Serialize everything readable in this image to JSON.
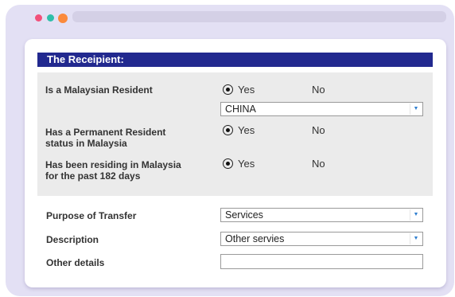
{
  "window": {
    "dots": {
      "red": "#f2507a",
      "yellow": "#2ebfa9",
      "orange": "#fb8a3c"
    }
  },
  "section": {
    "title": "The Receipient:"
  },
  "questions": {
    "malaysian_resident": {
      "label": "Is a Malaysian Resident",
      "yes_label": "Yes",
      "no_label": "No",
      "selected": "Yes"
    },
    "country_select": {
      "value": "CHINA"
    },
    "permanent_resident": {
      "label_line1": "Has a Permanent Resident",
      "label_line2": "status in Malaysia",
      "yes_label": "Yes",
      "no_label": "No",
      "selected": "Yes"
    },
    "residing_182": {
      "label_line1": "Has been residing in Malaysia",
      "label_line2": "for the past 182 days",
      "yes_label": "Yes",
      "no_label": "No",
      "selected": "Yes"
    }
  },
  "fields": {
    "purpose": {
      "label": "Purpose of Transfer",
      "value": "Services"
    },
    "description": {
      "label": "Description",
      "value": "Other servies"
    },
    "other_details": {
      "label": "Other details",
      "value": ""
    }
  },
  "colors": {
    "header_bg": "#22298f",
    "frame_bg": "#e3e0f4",
    "panel_bg": "#ebebeb",
    "select_arrow": "#2f7fd0"
  }
}
